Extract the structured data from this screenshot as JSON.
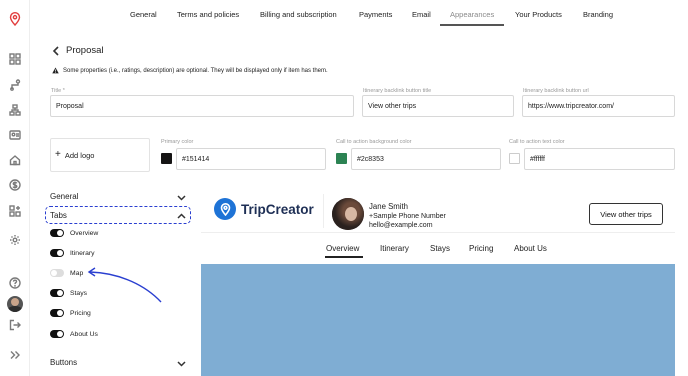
{
  "nav": {
    "tabs": [
      {
        "label": "General"
      },
      {
        "label": "Terms and policies"
      },
      {
        "label": "Billing and subscription"
      },
      {
        "label": "Payments"
      },
      {
        "label": "Email"
      },
      {
        "label": "Appearances",
        "active": true
      },
      {
        "label": "Your Products"
      },
      {
        "label": "Branding"
      }
    ]
  },
  "sidebar_icons": [
    "location-pin-icon",
    "dashboard-icon",
    "route-icon",
    "hierarchy-icon",
    "contact-card-icon",
    "home-icon",
    "dollar-icon",
    "add-widget-icon",
    "settings-icon",
    "help-icon",
    "avatar",
    "logout-icon",
    "expand-icon"
  ],
  "header": {
    "title": "Proposal",
    "notice": "Some properties (i.e., ratings, description) are optional. They will be displayed only if item has them."
  },
  "form": {
    "title_label": "Title *",
    "title_value": "Proposal",
    "backlink_title_label": "Itinerary backlink button title",
    "backlink_title_value": "View other trips",
    "backlink_url_label": "Itinerary backlink button url",
    "backlink_url_value": "https://www.tripcreator.com/",
    "add_logo_label": "Add logo",
    "primary_color_label": "Primary color",
    "primary_color_value": "#151414",
    "cta_bg_label": "Call to action background color",
    "cta_bg_value": "#2c8353",
    "cta_text_label": "Call to action text color",
    "cta_text_value": "#ffffff"
  },
  "settings": {
    "general_label": "General",
    "tabs_label": "Tabs",
    "buttons_label": "Buttons",
    "toggles": [
      {
        "label": "Overview",
        "on": true
      },
      {
        "label": "Itinerary",
        "on": true
      },
      {
        "label": "Map",
        "on": false
      },
      {
        "label": "Stays",
        "on": true
      },
      {
        "label": "Pricing",
        "on": true
      },
      {
        "label": "About Us",
        "on": true
      }
    ]
  },
  "preview": {
    "brand_name": "TripCreator",
    "agent_name": "Jane Smith",
    "agent_phone": "+Sample Phone Number",
    "agent_email": "hello@example.com",
    "cta_label": "View other trips",
    "tabs": [
      "Overview",
      "Itinerary",
      "Stays",
      "Pricing",
      "About Us"
    ],
    "active_tab": "Overview"
  },
  "colors": {
    "primary": "#151414",
    "cta_bg": "#2c8353",
    "cta_text": "#ffffff",
    "highlight": "#2a3fd0",
    "brand_blue": "#1e73d6",
    "map_blue": "#7fadd3"
  }
}
